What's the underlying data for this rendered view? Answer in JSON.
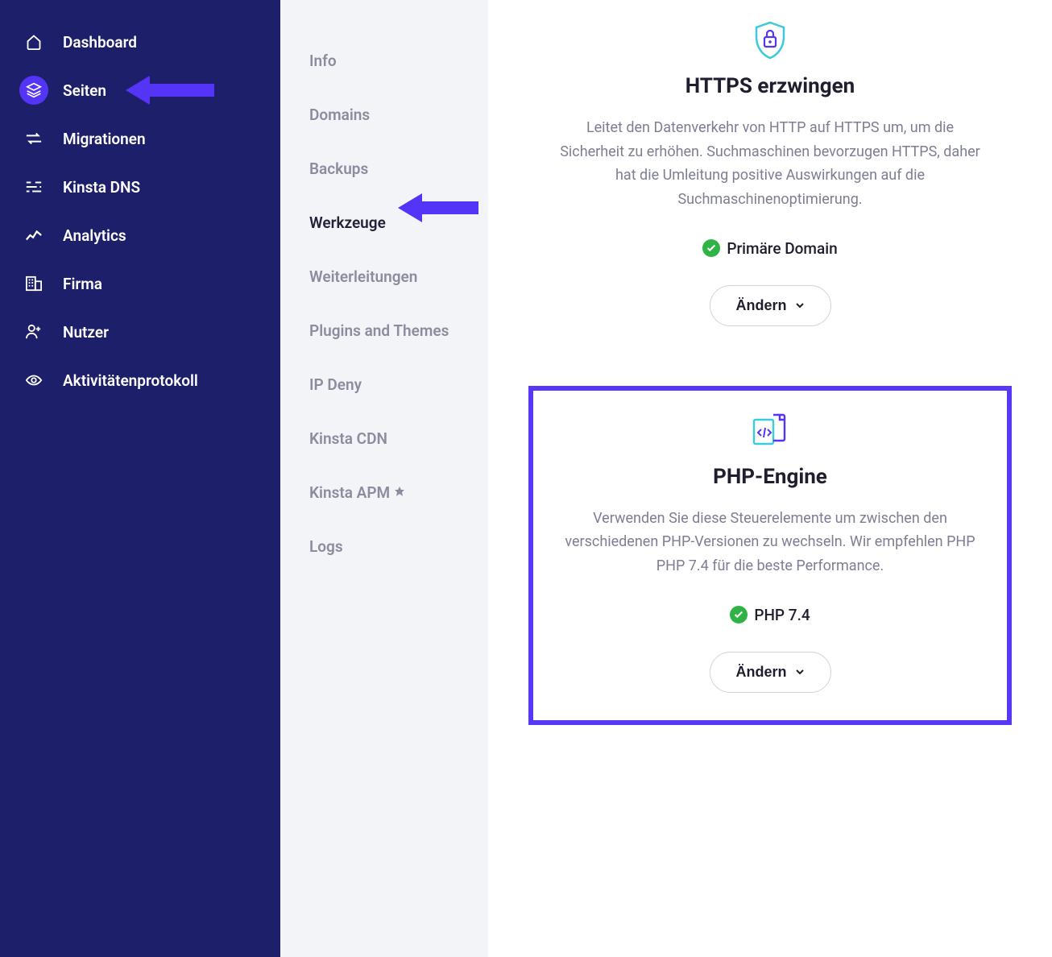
{
  "sidebar": {
    "items": [
      {
        "id": "dashboard",
        "label": "Dashboard",
        "icon": "home"
      },
      {
        "id": "seiten",
        "label": "Seiten",
        "icon": "layers",
        "active": true
      },
      {
        "id": "migrationen",
        "label": "Migrationen",
        "icon": "migration"
      },
      {
        "id": "kinsta-dns",
        "label": "Kinsta DNS",
        "icon": "dns"
      },
      {
        "id": "analytics",
        "label": "Analytics",
        "icon": "chart"
      },
      {
        "id": "firma",
        "label": "Firma",
        "icon": "building"
      },
      {
        "id": "nutzer",
        "label": "Nutzer",
        "icon": "user-plus"
      },
      {
        "id": "aktivitaeten",
        "label": "Aktivitätenprotokoll",
        "icon": "eye"
      }
    ]
  },
  "subnav": {
    "items": [
      {
        "id": "info",
        "label": "Info"
      },
      {
        "id": "domains",
        "label": "Domains"
      },
      {
        "id": "backups",
        "label": "Backups"
      },
      {
        "id": "werkzeuge",
        "label": "Werkzeuge",
        "active": true
      },
      {
        "id": "weiterleitungen",
        "label": "Weiterleitungen"
      },
      {
        "id": "plugins-themes",
        "label": "Plugins and Themes"
      },
      {
        "id": "ip-deny",
        "label": "IP Deny"
      },
      {
        "id": "kinsta-cdn",
        "label": "Kinsta CDN"
      },
      {
        "id": "kinsta-apm",
        "label": "Kinsta APM",
        "badge": true
      },
      {
        "id": "logs",
        "label": "Logs"
      }
    ]
  },
  "cards": {
    "https": {
      "title": "HTTPS erzwingen",
      "description": "Leitet den Datenverkehr von HTTP auf HTTPS um, um die Sicherheit zu erhöhen. Suchmaschinen bevorzugen HTTPS, daher hat die Umleitung positive Auswirkungen auf die Suchmaschinenoptimierung.",
      "status_label": "Primäre Domain",
      "button_label": "Ändern"
    },
    "php": {
      "title": "PHP-Engine",
      "description": "Verwenden Sie diese Steuerelemente um zwischen den verschiedenen PHP-Versionen zu wechseln. Wir empfehlen PHP PHP 7.4 für die beste Performance.",
      "status_label": "PHP 7.4",
      "button_label": "Ändern"
    }
  },
  "colors": {
    "sidebar_bg": "#1e1f6a",
    "accent": "#5434f6",
    "highlight_border": "#5837f7",
    "success": "#2fb344",
    "subnav_bg": "#f3f4f8",
    "text_muted": "#7d7e93"
  }
}
